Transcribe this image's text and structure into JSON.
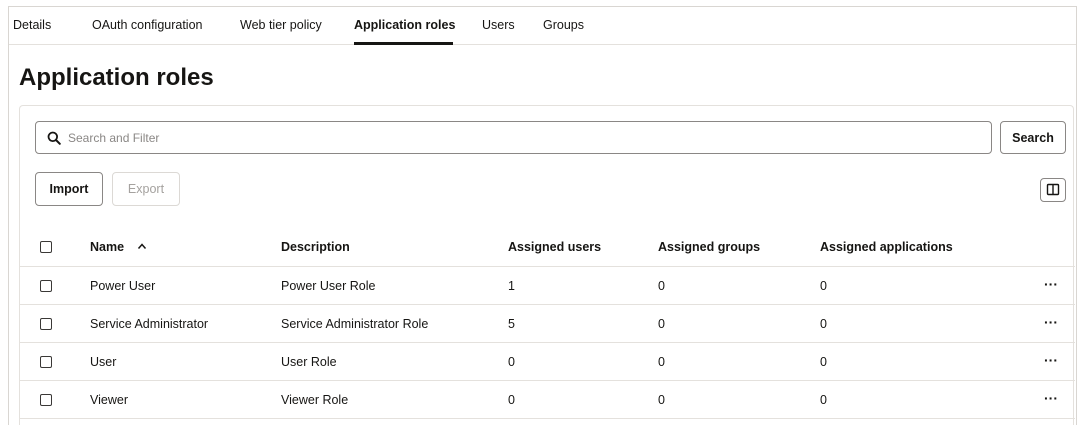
{
  "tabs": [
    {
      "label": "Details"
    },
    {
      "label": "OAuth configuration"
    },
    {
      "label": "Web tier policy"
    },
    {
      "label": "Application roles"
    },
    {
      "label": "Users"
    },
    {
      "label": "Groups"
    }
  ],
  "active_tab": "Application roles",
  "page": {
    "title": "Application roles"
  },
  "search": {
    "placeholder": "Search and Filter",
    "value": "",
    "button_label": "Search"
  },
  "toolbar": {
    "import_label": "Import",
    "export_label": "Export"
  },
  "table": {
    "columns": [
      "Name",
      "Description",
      "Assigned users",
      "Assigned groups",
      "Assigned applications"
    ],
    "sort_column": "Name",
    "sort_direction": "ascending",
    "rows": [
      {
        "name": "Power User",
        "description": "Power User Role",
        "assigned_users": "1",
        "assigned_groups": "0",
        "assigned_applications": "0",
        "actions": "···"
      },
      {
        "name": "Service Administrator",
        "description": "Service Administrator Role",
        "assigned_users": "5",
        "assigned_groups": "0",
        "assigned_applications": "0",
        "actions": "···"
      },
      {
        "name": "User",
        "description": "User Role",
        "assigned_users": "0",
        "assigned_groups": "0",
        "assigned_applications": "0",
        "actions": "···"
      },
      {
        "name": "Viewer",
        "description": "Viewer Role",
        "assigned_users": "0",
        "assigned_groups": "0",
        "assigned_applications": "0",
        "actions": "···"
      }
    ]
  }
}
